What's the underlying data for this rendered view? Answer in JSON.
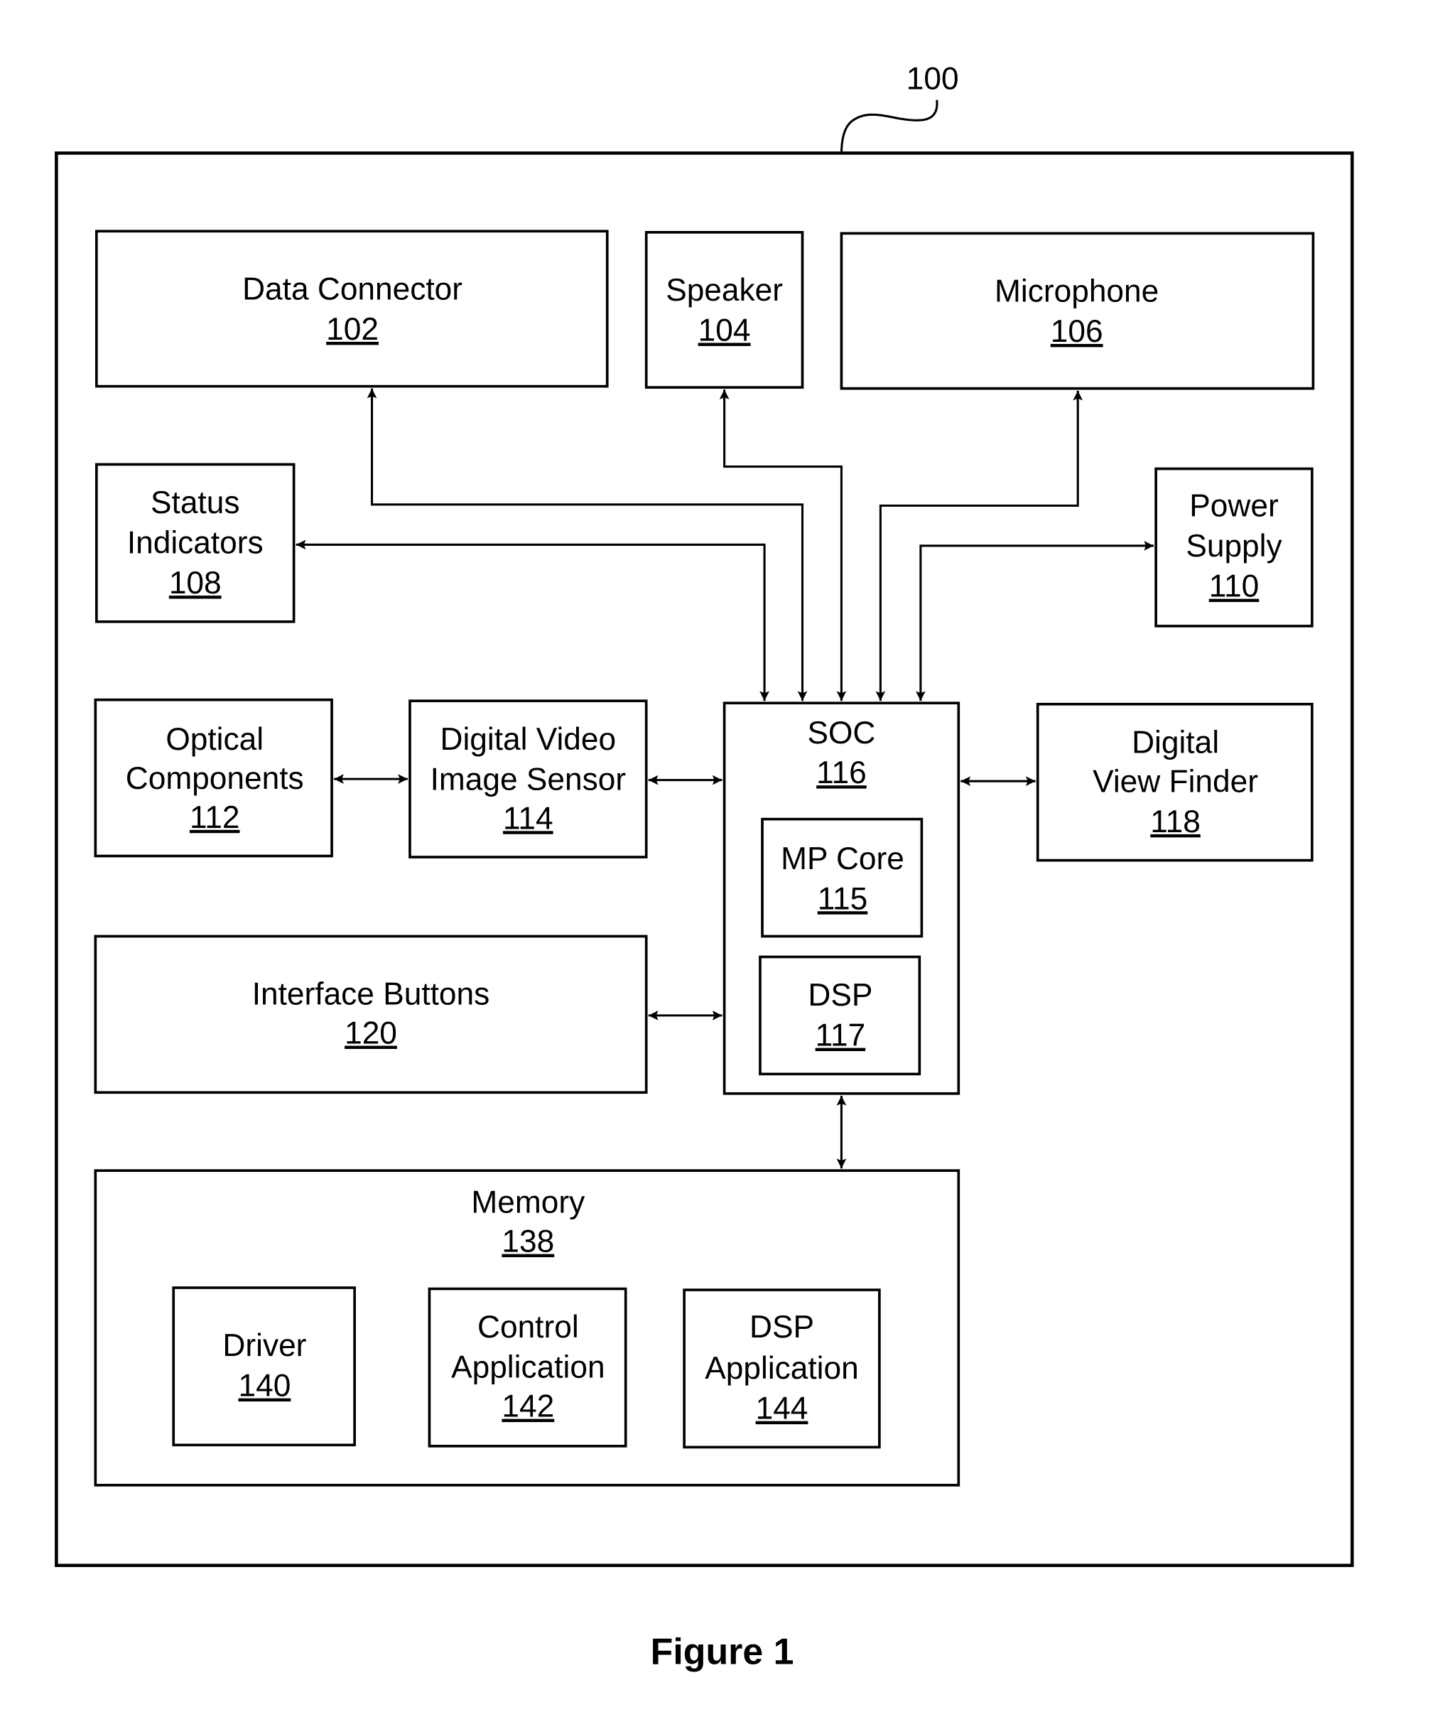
{
  "figure": {
    "reference": "100",
    "caption": "Figure 1"
  },
  "blocks": {
    "data_connector": {
      "lines": [
        "Data Connector"
      ],
      "ref": "102"
    },
    "speaker": {
      "lines": [
        "Speaker"
      ],
      "ref": "104"
    },
    "microphone": {
      "lines": [
        "Microphone"
      ],
      "ref": "106"
    },
    "status_indicators": {
      "lines": [
        "Status",
        "Indicators"
      ],
      "ref": "108"
    },
    "power_supply": {
      "lines": [
        "Power",
        "Supply"
      ],
      "ref": "110"
    },
    "optical_components": {
      "lines": [
        "Optical",
        "Components"
      ],
      "ref": "112"
    },
    "video_sensor": {
      "lines": [
        "Digital Video",
        "Image Sensor"
      ],
      "ref": "114"
    },
    "soc": {
      "lines": [
        "SOC"
      ],
      "ref": "116"
    },
    "mp_core": {
      "lines": [
        "MP Core"
      ],
      "ref": "115"
    },
    "dsp": {
      "lines": [
        "DSP"
      ],
      "ref": "117"
    },
    "view_finder": {
      "lines": [
        "Digital",
        "View Finder"
      ],
      "ref": "118"
    },
    "interface_buttons": {
      "lines": [
        "Interface Buttons"
      ],
      "ref": "120"
    },
    "memory": {
      "lines": [
        "Memory"
      ],
      "ref": "138"
    },
    "driver": {
      "lines": [
        "Driver"
      ],
      "ref": "140"
    },
    "control_app": {
      "lines": [
        "Control",
        "Application"
      ],
      "ref": "142"
    },
    "dsp_app": {
      "lines": [
        "DSP",
        "Application"
      ],
      "ref": "144"
    }
  },
  "connections": [
    {
      "from": "soc",
      "to": "data_connector",
      "direction": "to"
    },
    {
      "from": "soc",
      "to": "speaker",
      "direction": "to"
    },
    {
      "from": "soc",
      "to": "microphone",
      "direction": "to"
    },
    {
      "from": "soc",
      "to": "status_indicators",
      "direction": "both"
    },
    {
      "from": "soc",
      "to": "power_supply",
      "direction": "both"
    },
    {
      "from": "optical_components",
      "to": "video_sensor",
      "direction": "both"
    },
    {
      "from": "video_sensor",
      "to": "soc",
      "direction": "both"
    },
    {
      "from": "soc",
      "to": "view_finder",
      "direction": "both"
    },
    {
      "from": "interface_buttons",
      "to": "soc",
      "direction": "both"
    },
    {
      "from": "soc",
      "to": "memory",
      "direction": "both"
    }
  ]
}
